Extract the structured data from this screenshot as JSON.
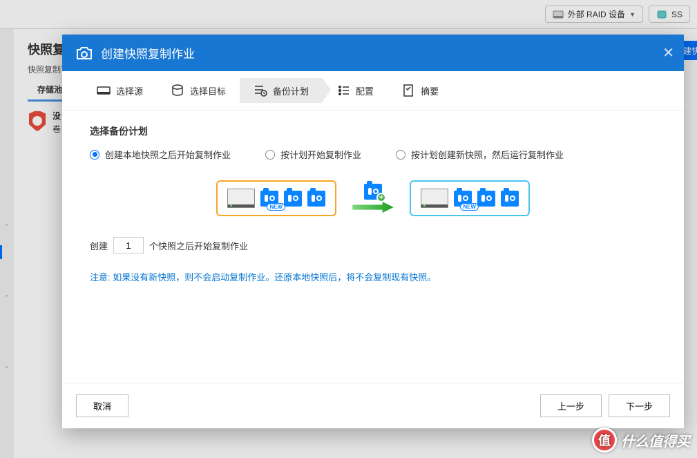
{
  "toolbar": {
    "raid_btn": "外部 RAID 设备",
    "ssd_btn": "SS"
  },
  "page": {
    "title": "快照复制",
    "desc": "快照复制可",
    "tab": "存储池",
    "alert_line1": "没",
    "alert_line2": "卷",
    "create_btn": "建快"
  },
  "modal": {
    "title": "创建快照复制作业"
  },
  "steps": {
    "s1": "选择源",
    "s2": "选择目标",
    "s3": "备份计划",
    "s4": "配置",
    "s5": "摘要"
  },
  "body": {
    "section_title": "选择备份计划",
    "option1": "创建本地快照之后开始复制作业",
    "option2": "按计划开始复制作业",
    "option3": "按计划创建新快照，然后运行复制作业",
    "new_badge": "NEW",
    "create_label": "创建",
    "create_value": "1",
    "create_suffix": "个快照之后开始复制作业",
    "note": "注意: 如果没有新快照，则不会启动复制作业。还原本地快照后，将不会复制现有快照。"
  },
  "footer": {
    "cancel": "取消",
    "prev": "上一步",
    "next": "下一步"
  },
  "watermark": {
    "badge": "值",
    "text": "什么值得买"
  }
}
